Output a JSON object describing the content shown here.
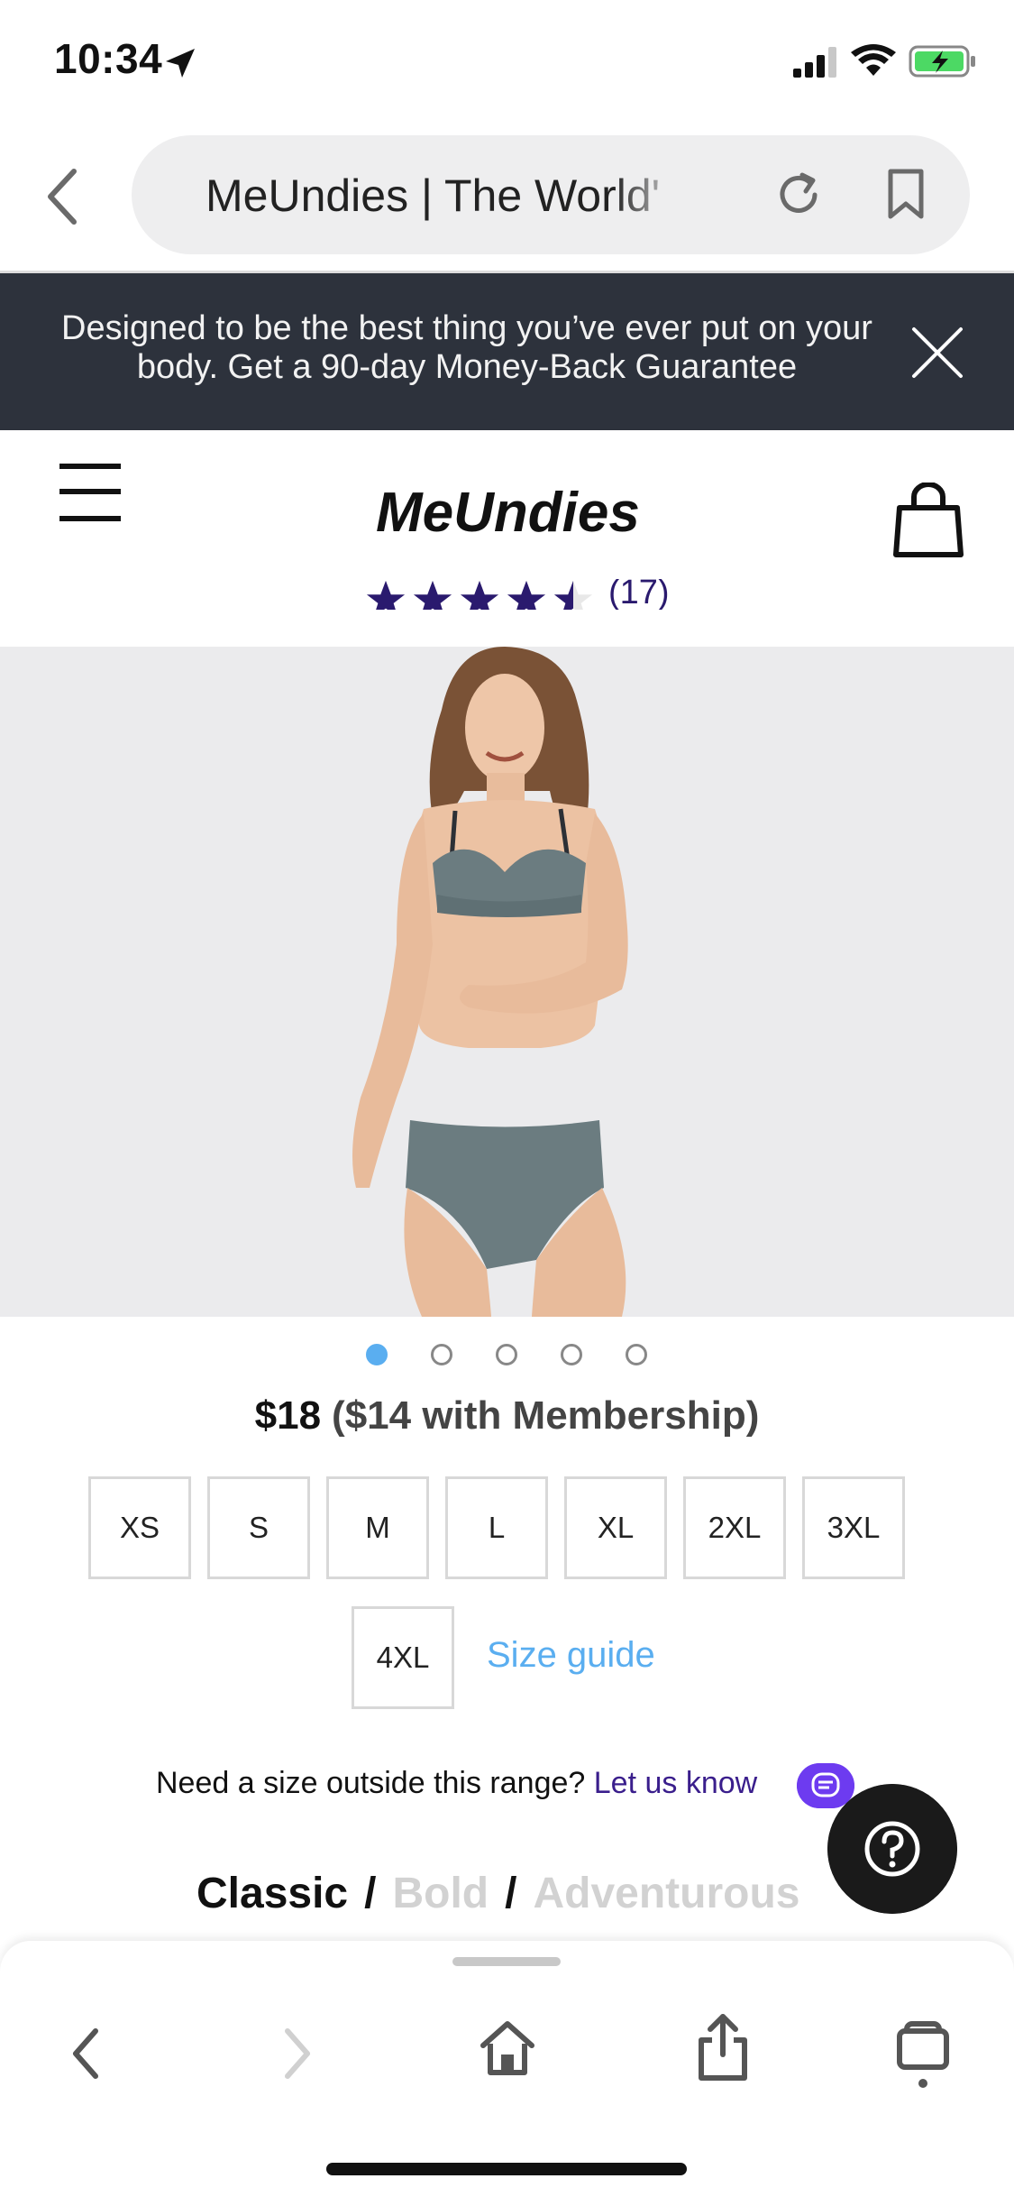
{
  "status_bar": {
    "time": "10:34"
  },
  "address_bar": {
    "url_text": "MeUndies | The World'"
  },
  "promo_banner": {
    "text": "Designed to be the best thing you’ve ever put on your body. Get a 90-day Money-Back Guarantee"
  },
  "header": {
    "logo_text": "MeUndies"
  },
  "rating": {
    "stars": 4.5,
    "count_text": "(17)"
  },
  "carousel": {
    "total": 5,
    "active_index": 0
  },
  "price": {
    "main": "$18",
    "member": "($14 with Membership)"
  },
  "sizes": [
    "XS",
    "S",
    "M",
    "L",
    "XL",
    "2XL",
    "3XL",
    "4XL"
  ],
  "size_guide": "Size guide",
  "outside_range": {
    "question": "Need a size outside this range?",
    "link": "Let us know"
  },
  "styles": {
    "classic": "Classic",
    "bold": "Bold",
    "adventurous": "Adventurous",
    "separator": "/"
  },
  "colors": {
    "accent_blue": "#5aaef0",
    "brand_purple": "#3a1e8c",
    "banner_bg": "#2d323c",
    "chat_purple": "#6d3bf0"
  }
}
